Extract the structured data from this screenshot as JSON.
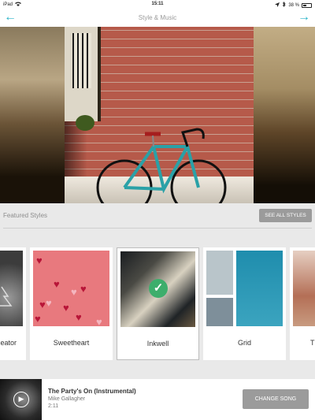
{
  "status_bar": {
    "device": "iPad",
    "time": "15:11",
    "battery": "38 %",
    "icons": [
      "wifi-icon",
      "location-arrow-icon",
      "bluetooth-icon",
      "battery-icon"
    ]
  },
  "nav": {
    "title": "Style & Music",
    "back_icon": "arrow-left-icon",
    "next_icon": "arrow-right-icon",
    "accent_color": "#27b3c7"
  },
  "featured": {
    "label": "Featured Styles",
    "see_all_label": "SEE ALL STYLES"
  },
  "styles": [
    {
      "label": "eator",
      "selected": false
    },
    {
      "label": "Sweetheart",
      "selected": false
    },
    {
      "label": "Inkwell",
      "selected": true
    },
    {
      "label": "Grid",
      "selected": false
    },
    {
      "label": "T",
      "selected": false
    }
  ],
  "song": {
    "title": "The Party's On (Instrumental)",
    "artist": "Mike Gallagher",
    "duration": "2:11",
    "change_label": "CHANGE SONG"
  },
  "colors": {
    "selection_check": "#3dae6c",
    "button_gray": "#9b9b9b"
  }
}
